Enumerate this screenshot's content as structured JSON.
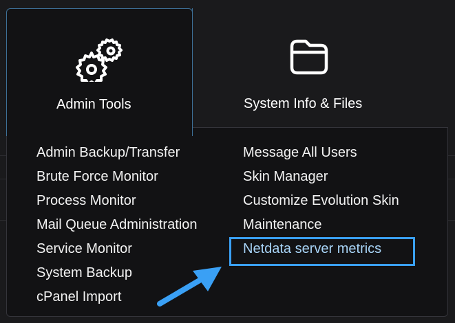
{
  "tabs": [
    {
      "label": "Admin Tools",
      "icon": "gears-icon",
      "active": true
    },
    {
      "label": "System Info & Files",
      "icon": "folder-icon",
      "active": false
    }
  ],
  "menu": {
    "left": [
      "Admin Backup/Transfer",
      "Brute Force Monitor",
      "Process Monitor",
      "Mail Queue Administration",
      "Service Monitor",
      "System Backup",
      "cPanel Import"
    ],
    "right": [
      "Message All Users",
      "Skin Manager",
      "Customize Evolution Skin",
      "Maintenance",
      "Netdata server metrics"
    ]
  },
  "annotation": {
    "highlighted_item": "Netdata server metrics",
    "highlight_color": "#3aa0f5",
    "arrow_color": "#3aa0f5"
  },
  "colors": {
    "background": "#121214",
    "active_tab_border": "#3d6f96",
    "text": "#ffffff",
    "highlight_text": "#a8d4f7"
  }
}
